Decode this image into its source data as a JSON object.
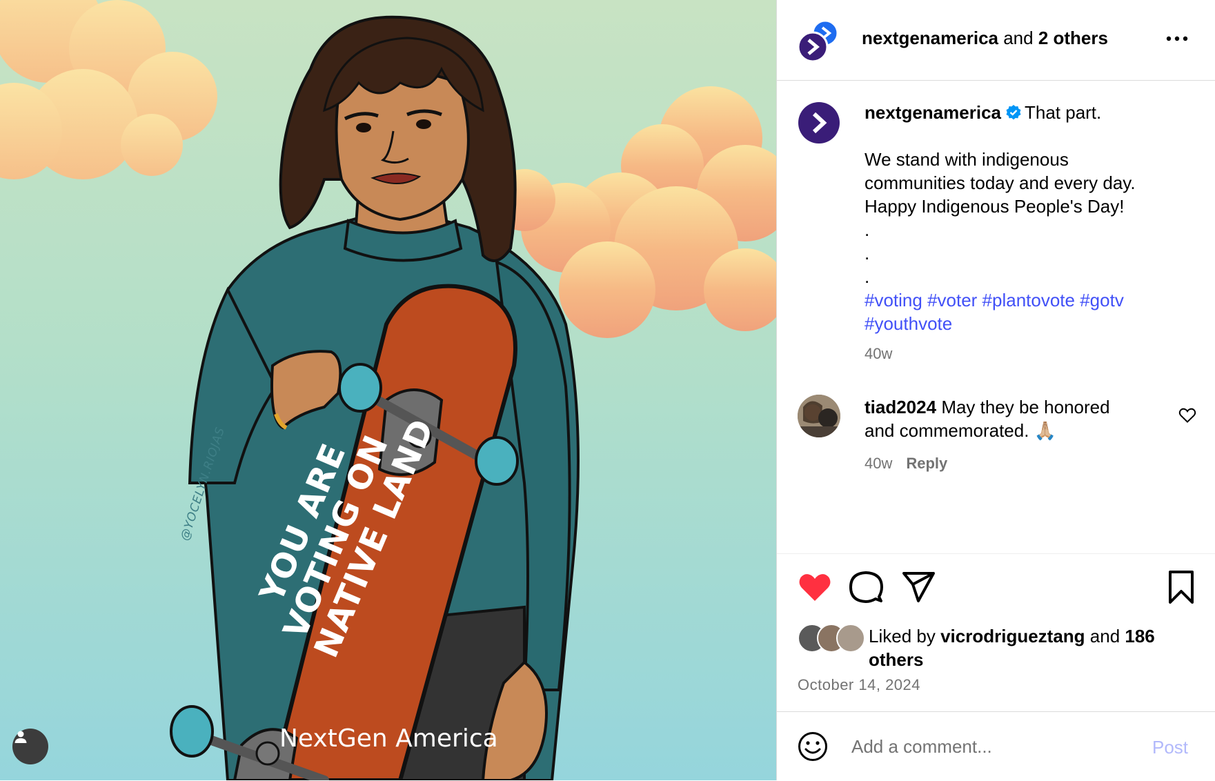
{
  "post_image": {
    "artist_credit": "@YOCELYN.RIOJAS",
    "deck_text_lines": [
      "YOU ARE",
      "VOTING ON",
      "NATIVE LAND"
    ],
    "watermark": "NextGen America",
    "icons": {
      "tagged_user": "person-icon"
    }
  },
  "header": {
    "username": "nextgenamerica",
    "connector": " and ",
    "others": "2 others",
    "icons": {
      "avatar": "collab-avatar",
      "more": "more-options-icon"
    }
  },
  "caption": {
    "username": "nextgenamerica",
    "first_line": "That part.",
    "lines": [
      "We stand with indigenous",
      "communities today and every day.",
      "Happy Indigenous People's Day!",
      ".",
      ".",
      "."
    ],
    "hashtags_line1": "#voting #voter #plantovote #gotv",
    "hashtags_line2": "#youthvote",
    "timestamp": "40w",
    "icons": {
      "verified": "verified-badge-icon"
    }
  },
  "comment": {
    "username": "tiad2024",
    "text_line1": "May they be honored",
    "text_line2": "and commemorated. 🙏🏼",
    "timestamp": "40w",
    "reply_label": "Reply",
    "icons": {
      "like": "heart-outline-icon"
    }
  },
  "actions": {
    "liked": true,
    "icons": [
      "heart-filled-icon",
      "comment-icon",
      "share-icon",
      "bookmark-icon"
    ]
  },
  "likes": {
    "prefix": "Liked by ",
    "username": "vicrodrigueztang",
    "connector": " and ",
    "count_text": "186 others"
  },
  "date": "October 14, 2024",
  "add_comment": {
    "placeholder": "Add a comment...",
    "post_label": "Post",
    "icons": {
      "emoji": "emoji-icon"
    }
  },
  "colors": {
    "link": "#4150f7",
    "muted": "#737373",
    "like_red": "#ff3040",
    "post_disabled": "#b2b9fb",
    "brand_purple": "#3a1d78",
    "verified_blue": "#0095f6"
  }
}
